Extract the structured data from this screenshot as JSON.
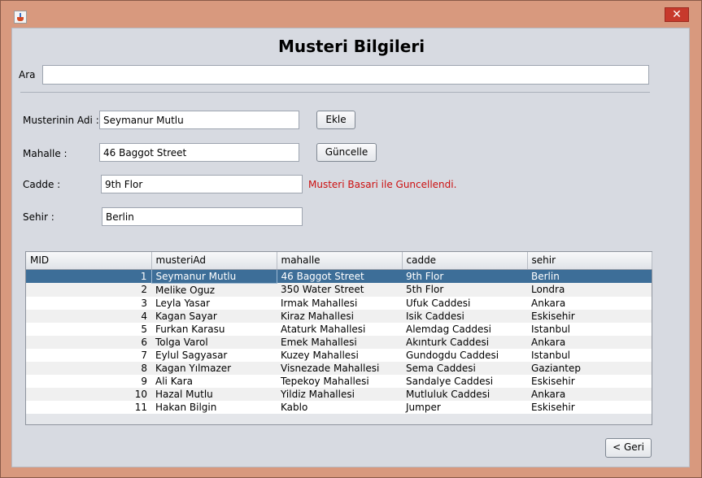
{
  "window": {
    "close_glyph": "✕",
    "icon": "java-cup-icon"
  },
  "page": {
    "title": "Musteri Bilgileri"
  },
  "search": {
    "label": "Ara",
    "value": ""
  },
  "form": {
    "name_label": "Musterinin Adi  :",
    "name_value": "Seymanur Mutlu",
    "mahalle_label": "Mahalle :",
    "mahalle_value": "46 Baggot Street",
    "cadde_label": "Cadde :",
    "cadde_value": "9th Flor",
    "sehir_label": "Sehir :",
    "sehir_value": "Berlin",
    "status_message": "Musteri Basari ile Guncellendi.",
    "status_color": "#cc1010"
  },
  "buttons": {
    "add": "Ekle",
    "update": "Güncelle",
    "back": "< Geri"
  },
  "table": {
    "columns": [
      "MID",
      "musteriAd",
      "mahalle",
      "cadde",
      "sehir"
    ],
    "selected_row": 0,
    "rows": [
      [
        "1",
        "Seymanur Mutlu",
        "46 Baggot Street",
        "9th Flor",
        "Berlin"
      ],
      [
        "2",
        "Melike Oguz",
        "350 Water Street",
        "5th Flor",
        "Londra"
      ],
      [
        "3",
        "Leyla Yasar",
        "Irmak Mahallesi",
        "Ufuk Caddesi",
        "Ankara"
      ],
      [
        "4",
        "Kagan Sayar",
        "Kiraz Mahallesi",
        "Isik Caddesi",
        "Eskisehir"
      ],
      [
        "5",
        "Furkan Karasu",
        "Ataturk Mahallesi",
        "Alemdag Caddesi",
        "Istanbul"
      ],
      [
        "6",
        "Tolga Varol",
        "Emek Mahallesi",
        "Akınturk Caddesi",
        "Ankara"
      ],
      [
        "7",
        "Eylul Sagyasar",
        "Kuzey Mahallesi",
        "Gundogdu Caddesi",
        "Istanbul"
      ],
      [
        "8",
        "Kagan Yılmazer",
        "Visnezade Mahallesi",
        "Sema Caddesi",
        "Gaziantep"
      ],
      [
        "9",
        "Ali Kara",
        "Tepekoy Mahallesi",
        "Sandalye Caddesi",
        "Eskisehir"
      ],
      [
        "10",
        "Hazal Mutlu",
        "Yildiz Mahallesi",
        "Mutluluk Caddesi",
        "Ankara"
      ],
      [
        "11",
        "Hakan Bilgin",
        "Kablo",
        "Jumper",
        "Eskisehir"
      ]
    ]
  },
  "colors": {
    "selection": "#3d6e98",
    "window_frame": "#d8997e",
    "panel": "#d7dae1"
  }
}
